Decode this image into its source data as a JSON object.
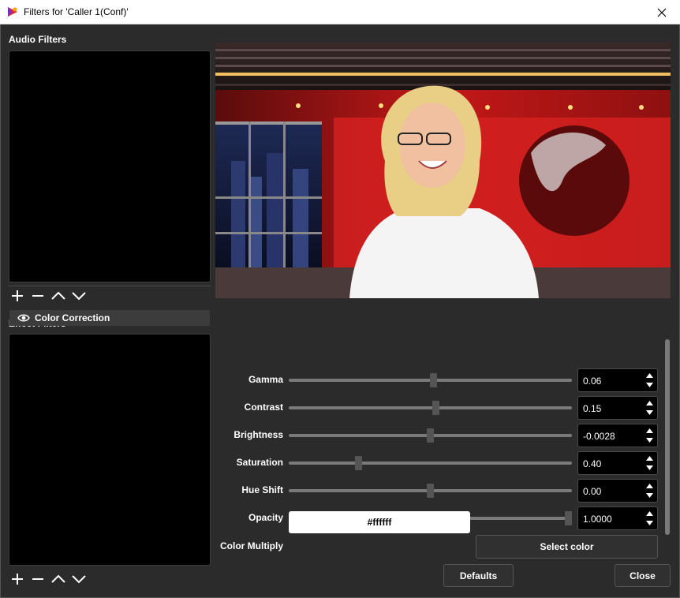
{
  "window": {
    "title": "Filters for 'Caller 1(Conf)'"
  },
  "audio_filters": {
    "label": "Audio Filters",
    "items": []
  },
  "effect_filters": {
    "label": "Effect Filters",
    "items": [
      {
        "label": "Color Correction",
        "visible": true
      }
    ]
  },
  "toolbar_icons": [
    "plus-icon",
    "minus-icon",
    "chevron-up-icon",
    "chevron-down-icon"
  ],
  "properties": {
    "gamma": {
      "label": "Gamma",
      "value": "0.06",
      "slider_level": 0.51
    },
    "contrast": {
      "label": "Contrast",
      "value": "0.15",
      "slider_level": 0.52
    },
    "brightness": {
      "label": "Brightness",
      "value": "-0.0028",
      "slider_level": 0.5
    },
    "saturation": {
      "label": "Saturation",
      "value": "0.40",
      "slider_level": 0.24
    },
    "hue_shift": {
      "label": "Hue Shift",
      "value": "0.00",
      "slider_level": 0.5
    },
    "opacity": {
      "label": "Opacity",
      "value": "1.0000",
      "slider_level": 1.0
    },
    "color_multiply": {
      "label": "Color Multiply",
      "value": "#ffffff",
      "button": "Select color"
    }
  },
  "buttons": {
    "defaults": "Defaults",
    "close": "Close"
  },
  "colors": {
    "background": "#2b2b2b",
    "list_bg": "#000000",
    "slider_track": "#7a7a7a",
    "slider_handle": "#555555",
    "accent_red": "#d41e1e"
  }
}
